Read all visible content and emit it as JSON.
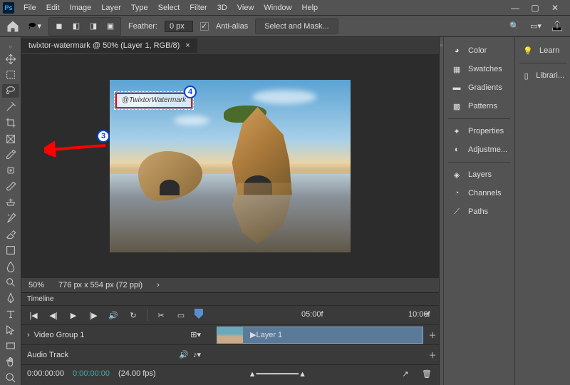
{
  "menubar": {
    "items": [
      "File",
      "Edit",
      "Image",
      "Layer",
      "Type",
      "Select",
      "Filter",
      "3D",
      "View",
      "Window",
      "Help"
    ]
  },
  "optbar": {
    "feather_label": "Feather:",
    "feather_value": "0 px",
    "antialias_label": "Anti-alias",
    "select_mask": "Select and Mask..."
  },
  "doc": {
    "tab_title": "twixtor-watermark @ 50% (Layer 1, RGB/8)",
    "zoom": "50%",
    "dims": "776 px x 554 px (72 ppi)",
    "watermark_text": "@TwixtorWatermark"
  },
  "panels": {
    "col1": [
      "Color",
      "Swatches",
      "Gradients",
      "Patterns",
      "Properties",
      "Adjustme...",
      "Layers",
      "Channels",
      "Paths"
    ],
    "col2": [
      "Learn",
      "Librari..."
    ]
  },
  "timeline": {
    "title": "Timeline",
    "times": [
      "05:00f",
      "10:00f"
    ],
    "group_label": "Video Group 1",
    "layer_label": "Layer 1",
    "audio_label": "Audio Track",
    "tc_start": "0:00:00:00",
    "tc_current": "0:00:00:00",
    "fps": "(24.00 fps)"
  },
  "callouts": {
    "c3": "3",
    "c4": "4"
  }
}
